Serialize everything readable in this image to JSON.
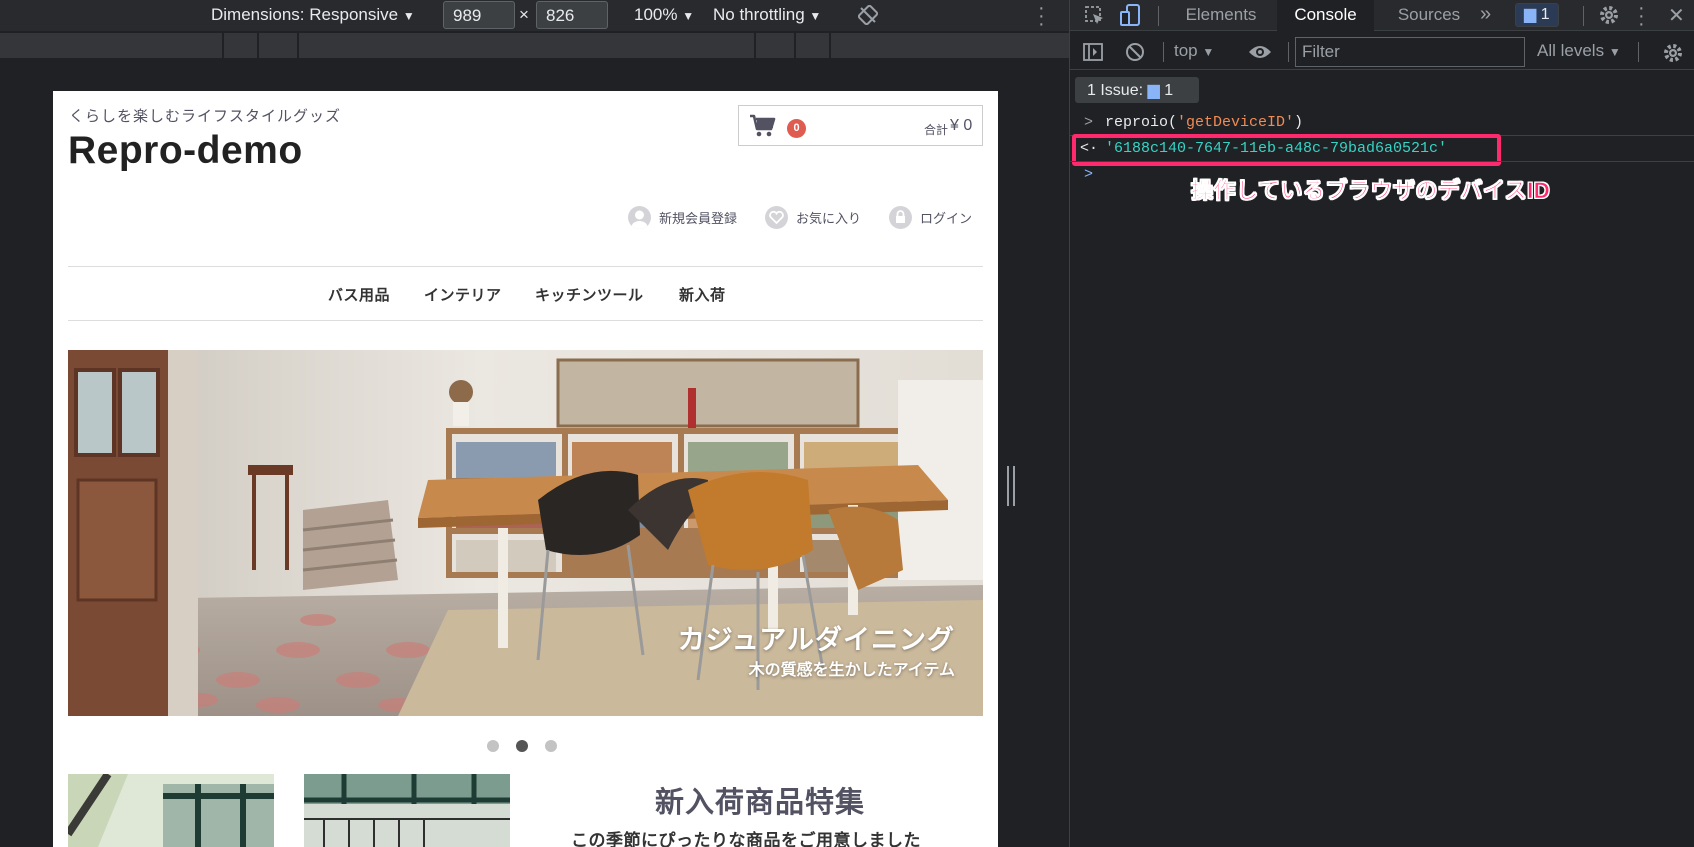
{
  "device_toolbar": {
    "dimensions_label": "Dimensions: Responsive",
    "width_value": "989",
    "times_sign": "×",
    "height_value": "826",
    "zoom_label": "100%",
    "throttling_label": "No throttling",
    "dropdown_arrow": "▼"
  },
  "site": {
    "tagline": "くらしを楽しむライフスタイルグッズ",
    "logo": "Repro-demo",
    "cart": {
      "count": "0",
      "total_label": "合計",
      "total_value": "¥ 0"
    },
    "member_links": [
      {
        "label": "新規会員登録",
        "icon": "user-icon"
      },
      {
        "label": "お気に入り",
        "icon": "heart-icon"
      },
      {
        "label": "ログイン",
        "icon": "lock-icon"
      }
    ],
    "nav": [
      {
        "label": "バス用品"
      },
      {
        "label": "インテリア"
      },
      {
        "label": "キッチンツール"
      },
      {
        "label": "新入荷"
      }
    ],
    "hero": {
      "caption_title": "カジュアルダイニング",
      "caption_sub": "木の質感を生かしたアイテム",
      "slide_count": 3,
      "active_slide": 2
    },
    "feature": {
      "title": "新入荷商品特集",
      "subtitle": "この季節にぴったりな商品をご用意しました"
    }
  },
  "devtools": {
    "tabs": [
      {
        "label": "Elements",
        "active": false
      },
      {
        "label": "Console",
        "active": true
      },
      {
        "label": "Sources",
        "active": false
      }
    ],
    "more_tabs": "»",
    "issues_count": "1",
    "context": "top",
    "filter_placeholder": "Filter",
    "levels_label": "All levels",
    "issues_bar": {
      "label": "1 Issue:",
      "count": "1"
    },
    "console": {
      "input_command": "reproio('getDeviceID')",
      "cmd_fn": "reproio(",
      "cmd_arg": "'getDeviceID'",
      "cmd_close": ")",
      "result": "'6188c140-7647-11eb-a48c-79bad6a0521c'",
      "prompt_symbol": ">",
      "result_symbol": "<·"
    },
    "annotation": "操作しているブラウザのデバイスID",
    "colors": {
      "highlight": "#ff2a6d",
      "string": "#35d4c7",
      "active_tab_bg": "#202124",
      "link_blue": "#8ab4f8"
    }
  }
}
